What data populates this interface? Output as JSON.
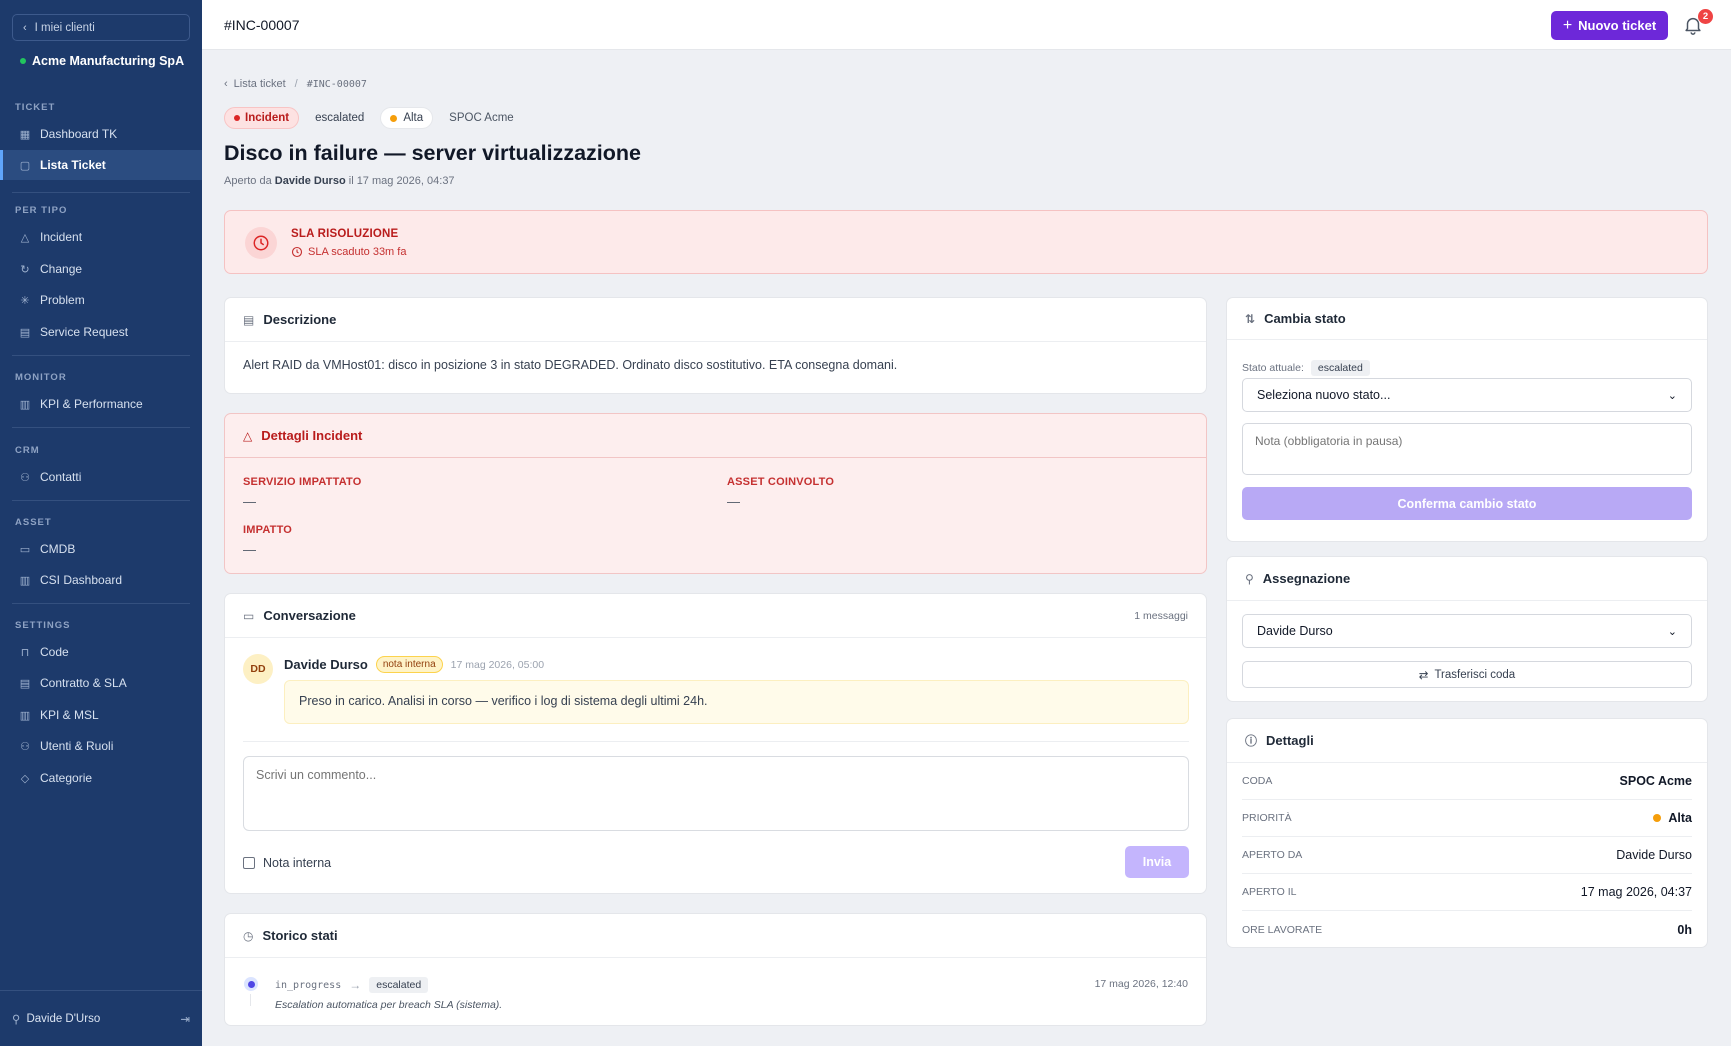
{
  "sidebar": {
    "back_label": "I miei clienti",
    "client_name": "Acme Manufacturing SpA",
    "sections": {
      "ticket": "TICKET",
      "per_tipo": "PER TIPO",
      "monitor": "MONITOR",
      "crm": "CRM",
      "asset": "ASSET",
      "settings": "SETTINGS"
    },
    "items": {
      "dashboard_tk": "Dashboard TK",
      "lista_ticket": "Lista Ticket",
      "incident": "Incident",
      "change": "Change",
      "problem": "Problem",
      "service_request": "Service Request",
      "kpi_performance": "KPI & Performance",
      "contatti": "Contatti",
      "cmdb": "CMDB",
      "csi_dashboard": "CSI Dashboard",
      "code": "Code",
      "contratto_sla": "Contratto & SLA",
      "kpi_msl": "KPI & MSL",
      "utenti_ruoli": "Utenti & Ruoli",
      "categorie": "Categorie"
    },
    "user_name": "Davide D'Urso"
  },
  "topbar": {
    "ticket_id": "#INC-00007",
    "new_ticket_label": "Nuovo ticket",
    "notification_count": "2"
  },
  "breadcrumb": {
    "parent": "Lista ticket",
    "current": "#INC-00007"
  },
  "ticket": {
    "type": "Incident",
    "status": "escalated",
    "priority": "Alta",
    "queue": "SPOC Acme",
    "title": "Disco in failure — server virtualizzazione",
    "opened_prefix": "Aperto da",
    "opened_by": "Davide Durso",
    "opened_suffix": "il 17 mag 2026, 04:37"
  },
  "sla": {
    "title": "SLA RISOLUZIONE",
    "status": "SLA scaduto 33m fa"
  },
  "description": {
    "title": "Descrizione",
    "text": "Alert RAID da VMHost01: disco in posizione 3 in stato DEGRADED. Ordinato disco sostitutivo. ETA consegna domani."
  },
  "incident_details": {
    "title": "Dettagli Incident",
    "service_label": "SERVIZIO IMPATTATO",
    "service_value": "—",
    "asset_label": "ASSET COINVOLTO",
    "asset_value": "—",
    "impact_label": "IMPATTO",
    "impact_value": "—"
  },
  "conversation": {
    "title": "Conversazione",
    "count": "1 messaggi",
    "message": {
      "initials": "DD",
      "author": "Davide Durso",
      "badge": "nota interna",
      "time": "17 mag 2026, 05:00",
      "text": "Preso in carico. Analisi in corso — verifico i log di sistema degli ultimi 24h."
    },
    "comment_placeholder": "Scrivi un commento...",
    "internal_note_label": "Nota interna",
    "send_label": "Invia"
  },
  "history": {
    "title": "Storico stati",
    "from": "in_progress",
    "to": "escalated",
    "time": "17 mag 2026, 12:40",
    "note": "Escalation automatica per breach SLA (sistema)."
  },
  "change_status": {
    "title": "Cambia stato",
    "current_label": "Stato attuale:",
    "current_value": "escalated",
    "select_placeholder": "Seleziona nuovo stato...",
    "note_placeholder": "Nota (obbligatoria in pausa)",
    "confirm_label": "Conferma cambio stato"
  },
  "assignment": {
    "title": "Assegnazione",
    "assignee": "Davide Durso",
    "transfer_label": "Trasferisci coda"
  },
  "details": {
    "title": "Dettagli",
    "rows": [
      {
        "key": "CODA",
        "value": "SPOC Acme"
      },
      {
        "key": "PRIORITÀ",
        "value": "Alta"
      },
      {
        "key": "APERTO DA",
        "value": "Davide Durso"
      },
      {
        "key": "APERTO IL",
        "value": "17 mag 2026, 04:37"
      },
      {
        "key": "ORE LAVORATE",
        "value": "0h"
      }
    ]
  },
  "colors": {
    "sidebar_bg": "#1d3a6b",
    "accent": "#6d28d9",
    "danger": "#b91c1c",
    "priority_dot": "#f59e0b"
  }
}
